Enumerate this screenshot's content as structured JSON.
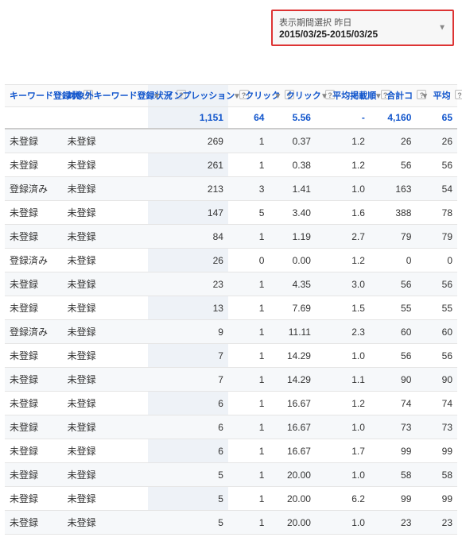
{
  "date_selector": {
    "label": "表示期間選択",
    "preset": "昨日",
    "range": "2015/03/25-2015/03/25"
  },
  "columns": {
    "kw1": "キーワード登録状",
    "kw2": "対象外キーワード登録状況",
    "imp": "インプレッション",
    "click": "クリック",
    "ctr": "クリック",
    "pos": "平均掲載順",
    "total": "合計コ",
    "avg": "平均"
  },
  "help": "?",
  "sort_desc": "▼",
  "totals": {
    "imp": "1,151",
    "click": "64",
    "ctr": "5.56",
    "pos": "-",
    "total": "4,160",
    "avg": "65"
  },
  "rows": [
    {
      "kw1": "未登録",
      "kw2": "未登録",
      "imp": "269",
      "click": "1",
      "ctr": "0.37",
      "pos": "1.2",
      "total": "26",
      "avg": "26"
    },
    {
      "kw1": "未登録",
      "kw2": "未登録",
      "imp": "261",
      "click": "1",
      "ctr": "0.38",
      "pos": "1.2",
      "total": "56",
      "avg": "56"
    },
    {
      "kw1": "登録済み",
      "kw2": "未登録",
      "imp": "213",
      "click": "3",
      "ctr": "1.41",
      "pos": "1.0",
      "total": "163",
      "avg": "54"
    },
    {
      "kw1": "未登録",
      "kw2": "未登録",
      "imp": "147",
      "click": "5",
      "ctr": "3.40",
      "pos": "1.6",
      "total": "388",
      "avg": "78"
    },
    {
      "kw1": "未登録",
      "kw2": "未登録",
      "imp": "84",
      "click": "1",
      "ctr": "1.19",
      "pos": "2.7",
      "total": "79",
      "avg": "79"
    },
    {
      "kw1": "登録済み",
      "kw2": "未登録",
      "imp": "26",
      "click": "0",
      "ctr": "0.00",
      "pos": "1.2",
      "total": "0",
      "avg": "0"
    },
    {
      "kw1": "未登録",
      "kw2": "未登録",
      "imp": "23",
      "click": "1",
      "ctr": "4.35",
      "pos": "3.0",
      "total": "56",
      "avg": "56"
    },
    {
      "kw1": "未登録",
      "kw2": "未登録",
      "imp": "13",
      "click": "1",
      "ctr": "7.69",
      "pos": "1.5",
      "total": "55",
      "avg": "55"
    },
    {
      "kw1": "登録済み",
      "kw2": "未登録",
      "imp": "9",
      "click": "1",
      "ctr": "11.11",
      "pos": "2.3",
      "total": "60",
      "avg": "60"
    },
    {
      "kw1": "未登録",
      "kw2": "未登録",
      "imp": "7",
      "click": "1",
      "ctr": "14.29",
      "pos": "1.0",
      "total": "56",
      "avg": "56"
    },
    {
      "kw1": "未登録",
      "kw2": "未登録",
      "imp": "7",
      "click": "1",
      "ctr": "14.29",
      "pos": "1.1",
      "total": "90",
      "avg": "90"
    },
    {
      "kw1": "未登録",
      "kw2": "未登録",
      "imp": "6",
      "click": "1",
      "ctr": "16.67",
      "pos": "1.2",
      "total": "74",
      "avg": "74"
    },
    {
      "kw1": "未登録",
      "kw2": "未登録",
      "imp": "6",
      "click": "1",
      "ctr": "16.67",
      "pos": "1.0",
      "total": "73",
      "avg": "73"
    },
    {
      "kw1": "未登録",
      "kw2": "未登録",
      "imp": "6",
      "click": "1",
      "ctr": "16.67",
      "pos": "1.7",
      "total": "99",
      "avg": "99"
    },
    {
      "kw1": "未登録",
      "kw2": "未登録",
      "imp": "5",
      "click": "1",
      "ctr": "20.00",
      "pos": "1.0",
      "total": "58",
      "avg": "58"
    },
    {
      "kw1": "未登録",
      "kw2": "未登録",
      "imp": "5",
      "click": "1",
      "ctr": "20.00",
      "pos": "6.2",
      "total": "99",
      "avg": "99"
    },
    {
      "kw1": "未登録",
      "kw2": "未登録",
      "imp": "5",
      "click": "1",
      "ctr": "20.00",
      "pos": "1.0",
      "total": "23",
      "avg": "23"
    }
  ]
}
